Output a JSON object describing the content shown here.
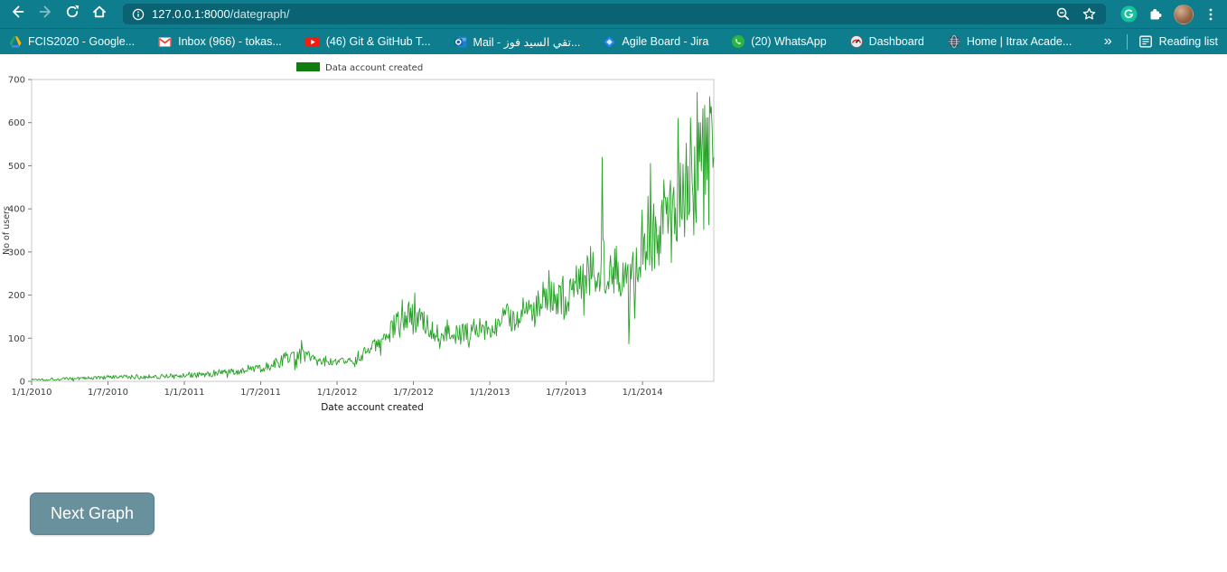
{
  "theme": {
    "toolbar_color": "#0e7d8d",
    "address_bar_color": "#0a6373",
    "button_color": "#68919d",
    "button_border": "#57808d"
  },
  "browser": {
    "url_host": "127.0.0.1:8000",
    "url_path": "/dategraph/",
    "bookmarks": [
      {
        "label": "FCIS2020 - Google...",
        "icon": "drive"
      },
      {
        "label": "Inbox (966) - tokas...",
        "icon": "gmail"
      },
      {
        "label": "(46) Git & GitHub T...",
        "icon": "youtube"
      },
      {
        "label": "Mail - تقي السيد فوز...",
        "icon": "outlook"
      },
      {
        "label": "Agile Board - Jira",
        "icon": "jira"
      },
      {
        "label": "(20) WhatsApp",
        "icon": "whatsapp"
      },
      {
        "label": "Dashboard",
        "icon": "dashboard"
      },
      {
        "label": "Home | Itrax Acade...",
        "icon": "globe"
      }
    ],
    "overflow_chevron": "»",
    "reading_list_label": "Reading list"
  },
  "page": {
    "next_button_label": "Next Graph"
  },
  "chart_data": {
    "type": "line",
    "title": "",
    "legend": [
      "Data account created"
    ],
    "xlabel": "Date account created",
    "ylabel": "No of users",
    "ylim": [
      0,
      700
    ],
    "y_ticks": [
      0,
      100,
      200,
      300,
      400,
      500,
      600,
      700
    ],
    "x_ticks": [
      "1/1/2010",
      "1/7/2010",
      "1/1/2011",
      "1/7/2011",
      "1/1/2012",
      "1/7/2012",
      "1/1/2013",
      "1/7/2013",
      "1/1/2014"
    ],
    "x_tick_interval_months": 6,
    "x_total_months": 53.6,
    "grid": false,
    "line_color": "#27a027",
    "legend_color": "#117d11",
    "trend_monthly": [
      [
        0,
        4,
        3
      ],
      [
        3,
        6,
        4
      ],
      [
        6,
        9,
        5
      ],
      [
        9,
        11,
        6
      ],
      [
        12,
        13,
        6
      ],
      [
        14,
        17,
        7
      ],
      [
        16,
        22,
        8
      ],
      [
        18,
        30,
        9
      ],
      [
        19.5,
        45,
        14
      ],
      [
        20.5,
        60,
        20
      ],
      [
        21.5,
        58,
        18
      ],
      [
        22.5,
        48,
        12
      ],
      [
        24,
        42,
        9
      ],
      [
        25,
        48,
        12
      ],
      [
        26,
        62,
        15
      ],
      [
        27,
        82,
        18
      ],
      [
        28,
        108,
        28
      ],
      [
        29,
        140,
        38
      ],
      [
        30,
        150,
        40
      ],
      [
        31,
        132,
        30
      ],
      [
        32,
        118,
        26
      ],
      [
        33,
        108,
        24
      ],
      [
        34,
        112,
        26
      ],
      [
        35,
        120,
        28
      ],
      [
        36,
        128,
        30
      ],
      [
        37,
        142,
        34
      ],
      [
        38,
        152,
        36
      ],
      [
        39,
        160,
        40
      ],
      [
        40,
        172,
        44
      ],
      [
        41,
        188,
        48
      ],
      [
        42,
        205,
        52
      ],
      [
        43,
        228,
        56
      ],
      [
        44,
        258,
        62
      ],
      [
        45,
        272,
        68
      ],
      [
        46,
        262,
        70
      ],
      [
        46.8,
        235,
        75
      ],
      [
        48,
        330,
        85
      ],
      [
        49,
        355,
        95
      ],
      [
        50,
        390,
        100
      ],
      [
        51,
        430,
        110
      ],
      [
        52,
        480,
        115
      ],
      [
        53,
        540,
        110
      ],
      [
        53.6,
        560,
        105
      ]
    ],
    "spikes": [
      [
        21.2,
        95
      ],
      [
        44.8,
        520
      ],
      [
        47.0,
        158
      ],
      [
        48.6,
        505
      ],
      [
        50.8,
        610
      ],
      [
        52.3,
        670
      ],
      [
        52.9,
        640
      ],
      [
        53.3,
        660
      ]
    ]
  }
}
